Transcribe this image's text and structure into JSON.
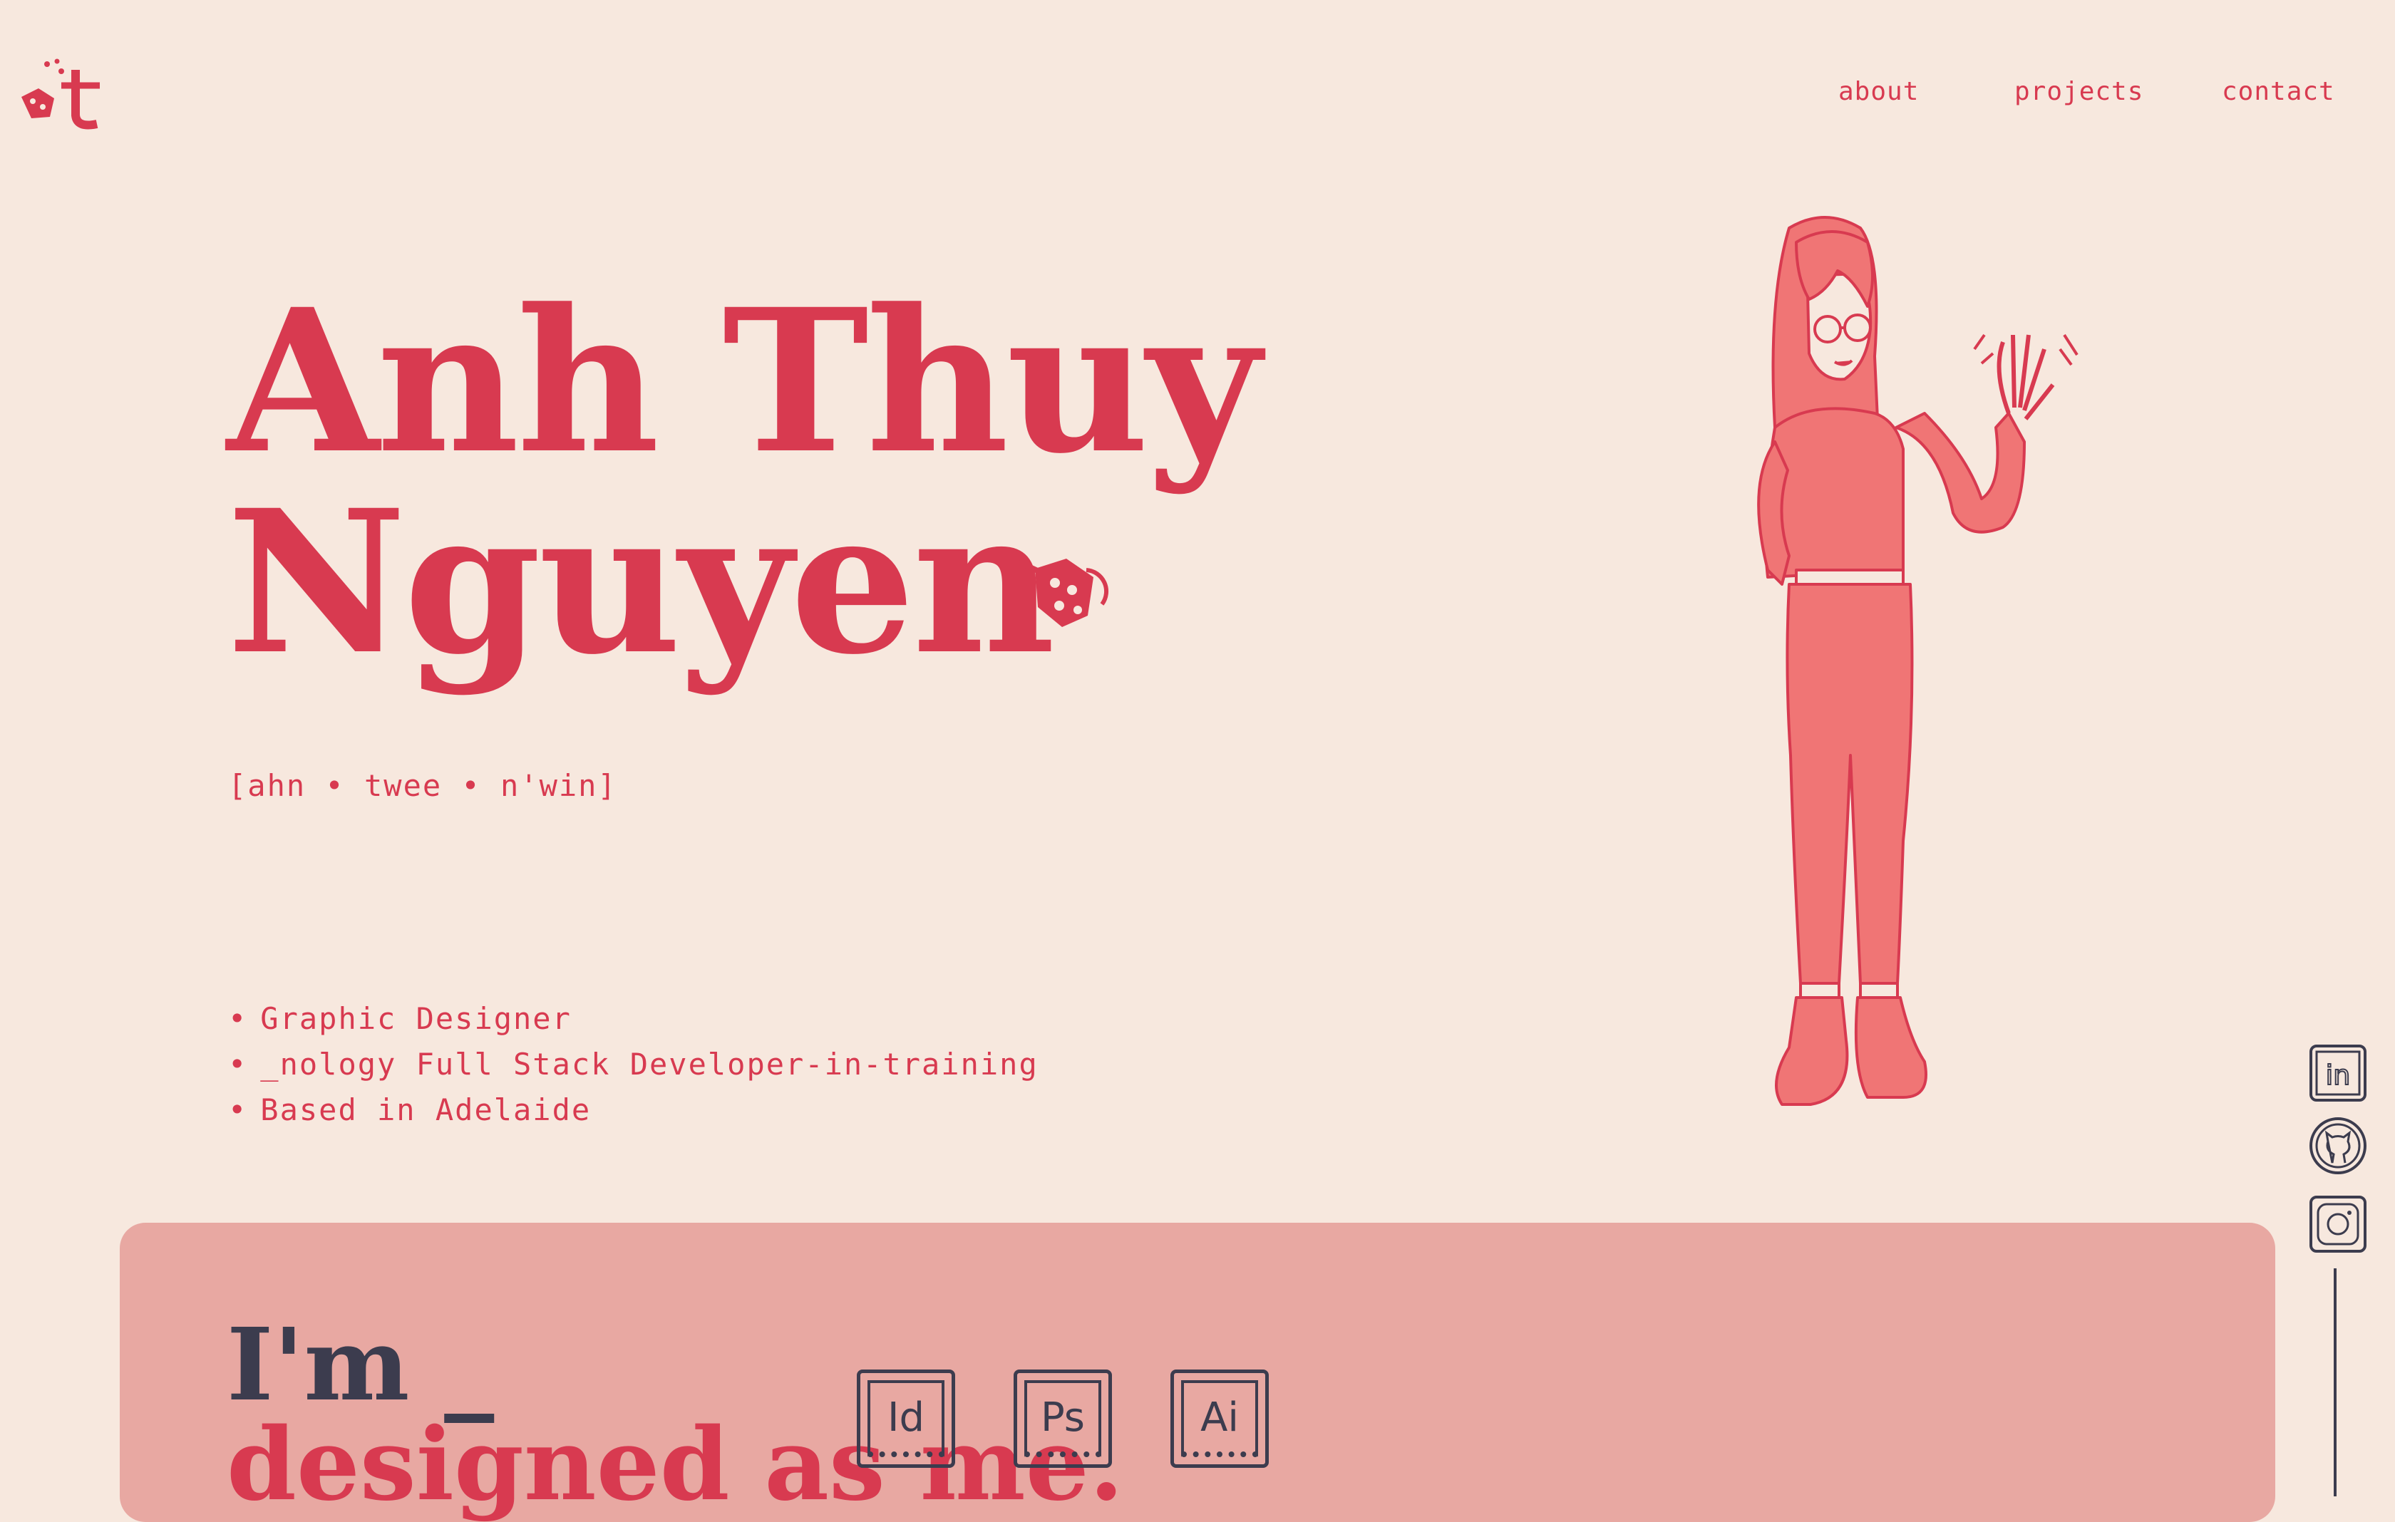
{
  "header": {
    "nav": {
      "about": "about",
      "projects": "projects",
      "contact": "contact"
    }
  },
  "hero": {
    "first_name": "Anh Thuy",
    "last_name": "Nguyen",
    "pronunciation": "[ahn • twee • n'win]",
    "roles": [
      "Graphic Designer",
      "_nology Full Stack Developer-in-training",
      "Based in Adelaide"
    ]
  },
  "intro": {
    "line1": "I'm _",
    "line2": "designed as me.",
    "tools": [
      "Id",
      "Ps",
      "Ai"
    ]
  },
  "social": {
    "icons": [
      "linkedin-icon",
      "github-icon",
      "instagram-icon"
    ]
  },
  "colors": {
    "background": "#f7e8de",
    "accent": "#d83a50",
    "panel": "#e8a8a2",
    "dark": "#3c3c4e"
  }
}
